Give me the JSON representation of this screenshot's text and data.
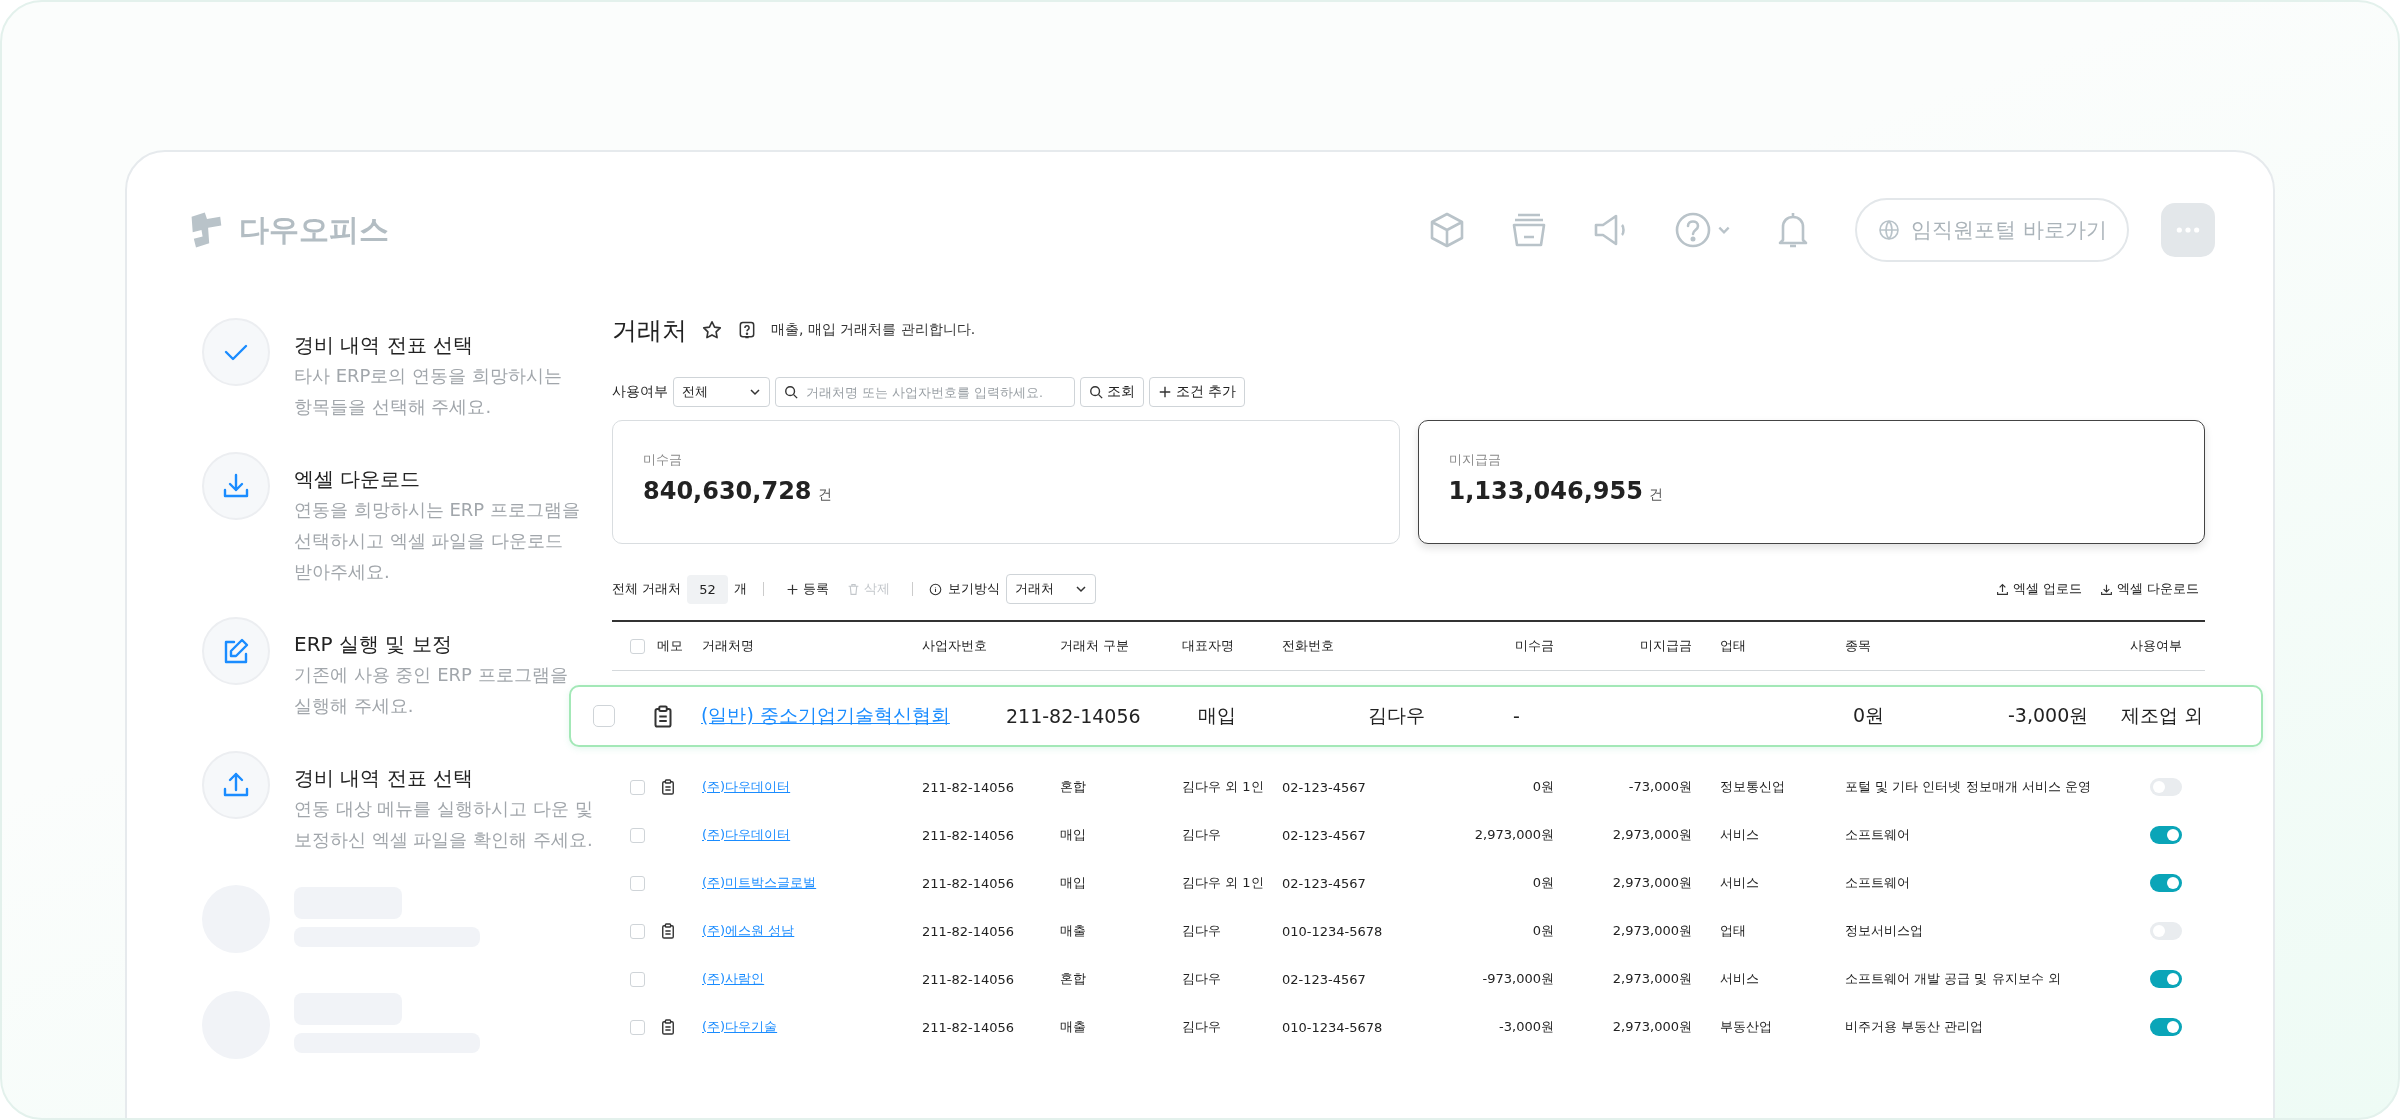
{
  "header": {
    "logo": "다우오피스",
    "portal_button": "임직원포털 바로가기"
  },
  "guide": [
    {
      "kind": "check",
      "title": "경비 내역 전표 선택",
      "lines": [
        "타사 ERP로의 연동을 희망하시는",
        "항목들을 선택해 주세요."
      ]
    },
    {
      "kind": "download",
      "title": "엑셀 다운로드",
      "lines": [
        "연동을 희망하시는 ERP 프로그램을",
        "선택하시고 엑셀 파일을 다운로드",
        "받아주세요."
      ]
    },
    {
      "kind": "edit",
      "title": "ERP 실행 및 보정",
      "lines": [
        "기존에 사용 중인 ERP 프로그램을",
        "실행해 주세요."
      ]
    },
    {
      "kind": "upload",
      "title": "경비 내역 전표 선택",
      "lines": [
        "연동 대상 메뉴를 실행하시고 다운 및",
        "보정하신 엑셀 파일을 확인해 주세요."
      ]
    }
  ],
  "page": {
    "title": "거래처",
    "subtitle": "매출, 매입 거래처를 관리합니다."
  },
  "filter": {
    "label": "사용여부",
    "select": "전체",
    "search_placeholder": "거래처명 또는 사업자번호를 입력하세요.",
    "search_button": "조회",
    "add_condition": "조건 추가"
  },
  "summary_cards": [
    {
      "label": "미수금",
      "value": "840,630,728",
      "unit": "건",
      "selected": false
    },
    {
      "label": "미지급금",
      "value": "1,133,046,955",
      "unit": "건",
      "selected": true
    }
  ],
  "toolbar": {
    "total_label": "전체 거래처",
    "total_count": "52",
    "count_unit": "개",
    "add": "등록",
    "delete": {
      "label": "삭제",
      "disabled": true
    },
    "view_label": "보기방식",
    "view_select": "거래처",
    "upload": "엑셀 업로드",
    "download": "엑셀 다운로드"
  },
  "table": {
    "all_checked": false,
    "columns": [
      "메모",
      "거래처명",
      "사업자번호",
      "거래처 구분",
      "대표자명",
      "전화번호",
      "미수금",
      "미지급금",
      "업태",
      "종목",
      "사용여부"
    ],
    "dragged_row": {
      "checked": false,
      "memo": true,
      "name": "(일반) 중소기업기술혁신협회",
      "cells": [
        "211-82-14056",
        "매입",
        "김다우",
        "-",
        "0원",
        "-3,000원",
        "제조업 외"
      ]
    },
    "rows": [
      {
        "checked": false,
        "memo": true,
        "name": "(주)다우데이터",
        "biz_no": "211-82-14056",
        "type": "혼합",
        "ceo": "김다우 외 1인",
        "phone": "02-123-4567",
        "receivable": "0원",
        "payable": "-73,000원",
        "industry": "정보통신업",
        "item": "포털 및 기타 인터넷 정보매개 서비스 운영",
        "in_use": false
      },
      {
        "checked": false,
        "memo": false,
        "name": "(주)다우데이터",
        "biz_no": "211-82-14056",
        "type": "매입",
        "ceo": "김다우",
        "phone": "02-123-4567",
        "receivable": "2,973,000원",
        "payable": "2,973,000원",
        "industry": "서비스",
        "item": "소프트웨어",
        "in_use": true
      },
      {
        "checked": false,
        "memo": false,
        "name": "(주)미트박스글로벌",
        "biz_no": "211-82-14056",
        "type": "매입",
        "ceo": "김다우 외 1인",
        "phone": "02-123-4567",
        "receivable": "0원",
        "payable": "2,973,000원",
        "industry": "서비스",
        "item": "소프트웨어",
        "in_use": true
      },
      {
        "checked": false,
        "memo": true,
        "name": "(주)에스원 성남",
        "biz_no": "211-82-14056",
        "type": "매출",
        "ceo": "김다우",
        "phone": "010-1234-5678",
        "receivable": "0원",
        "payable": "2,973,000원",
        "industry": "업태",
        "item": "정보서비스업",
        "in_use": false
      },
      {
        "checked": false,
        "memo": false,
        "name": "(주)사람인",
        "biz_no": "211-82-14056",
        "type": "혼합",
        "ceo": "김다우",
        "phone": "02-123-4567",
        "receivable": "-973,000원",
        "payable": "2,973,000원",
        "industry": "서비스",
        "item": "소프트웨어 개발 공급 및 유지보수 외",
        "in_use": true
      },
      {
        "checked": false,
        "memo": true,
        "name": "(주)다우기술",
        "biz_no": "211-82-14056",
        "type": "매출",
        "ceo": "김다우",
        "phone": "010-1234-5678",
        "receivable": "-3,000원",
        "payable": "2,973,000원",
        "industry": "부동산업",
        "item": "비주거용 부동산 관리업",
        "in_use": true
      }
    ]
  }
}
